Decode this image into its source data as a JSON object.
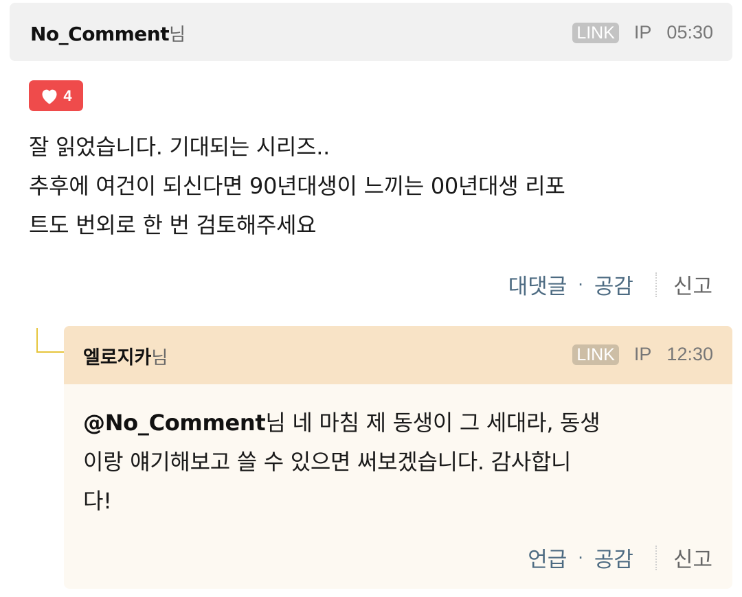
{
  "comment": {
    "author": "No_Comment",
    "honorific": "님",
    "link_badge": "LINK",
    "ip_label": "IP",
    "time": "05:30",
    "like_count": "4",
    "text": "잘 읽었습니다. 기대되는 시리즈..\n추후에 여건이 되신다면 90년대생이 느끼는 00년대생 리포\n트도 번외로 한 번 검토해주세요",
    "actions": {
      "reply": "대댓글",
      "dot": "·",
      "empathy": "공감",
      "report": "신고"
    }
  },
  "reply": {
    "author": "엘로지카",
    "honorific": "님",
    "link_badge": "LINK",
    "ip_label": "IP",
    "time": "12:30",
    "mention": "@No_Comment",
    "text": "님 네 마침 제 동생이 그 세대라, 동생\n이랑 얘기해보고 쓸 수 있으면 써보겠습니다. 감사합니\n다!",
    "actions": {
      "mention": "언급",
      "dot": "·",
      "empathy": "공감",
      "report": "신고"
    }
  },
  "colors": {
    "like_badge": "#ef4b4b",
    "reply_header": "#f8e3c6",
    "reply_body": "#fdf9f2",
    "action_link": "#4d6b82",
    "reply_connector": "#e6c53c"
  },
  "icons": {
    "like": "heart-icon"
  }
}
